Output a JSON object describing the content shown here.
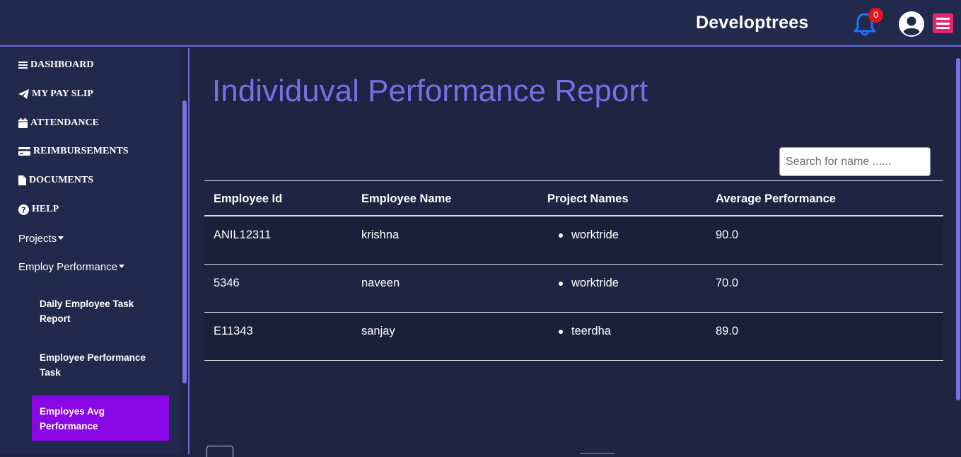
{
  "header": {
    "brand": "Developtrees",
    "notification_count": "0",
    "icons": [
      "bell-icon",
      "user-circle-icon",
      "hamburger-menu-icon"
    ],
    "menu_button_color": "#e8246e",
    "badge_color": "#e3161d",
    "bell_color": "#1a73ff"
  },
  "sidebar": {
    "items": [
      {
        "label": "DASHBOARD",
        "icon": "bars-icon"
      },
      {
        "label": "MY PAY SLIP",
        "icon": "paper-plane-icon"
      },
      {
        "label": "ATTENDANCE",
        "icon": "calendar-icon"
      },
      {
        "label": "REIMBURSEMENTS",
        "icon": "credit-card-icon"
      },
      {
        "label": "DOCUMENTS",
        "icon": "file-icon"
      },
      {
        "label": "HELP",
        "icon": "question-circle-icon"
      }
    ],
    "projects_label": "Projects",
    "performance_label": "Employ Performance",
    "sub_items": [
      "Daily Employee Task Report",
      "Employee Performance Task",
      "Employes Avg Performance"
    ],
    "active_sub_item": "Employes Avg Performance",
    "active_color": "#8a07e6"
  },
  "main": {
    "title": "Individuval Performance Report",
    "title_color": "#7a6ee6",
    "search": {
      "placeholder": "Search for name ......",
      "value": ""
    },
    "table": {
      "headers": [
        "Employee Id",
        "Employee Name",
        "Project Names",
        "Average Performance"
      ],
      "rows": [
        {
          "id": "ANIL12311",
          "name": "krishna",
          "project": "worktride",
          "avg": "90.0"
        },
        {
          "id": "5346",
          "name": "naveen",
          "project": "worktride",
          "avg": "70.0"
        },
        {
          "id": "E11343",
          "name": "sanjay",
          "project": "teerdha",
          "avg": "89.0"
        }
      ]
    }
  }
}
